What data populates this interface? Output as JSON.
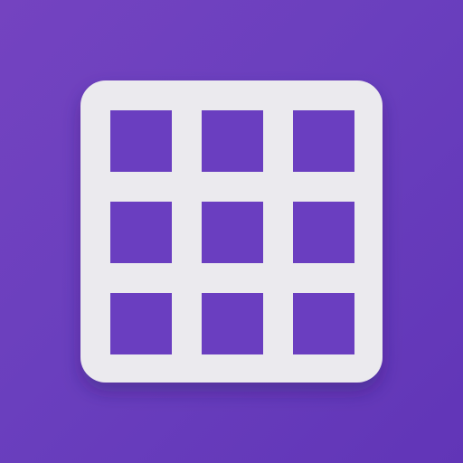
{
  "icon": {
    "name": "grid-icon",
    "rows": 3,
    "columns": 3
  },
  "colors": {
    "background_start": "#7443c0",
    "background_end": "#6135b7",
    "cell_fill": "#6a3ec0",
    "frame": "#ebeaee"
  }
}
